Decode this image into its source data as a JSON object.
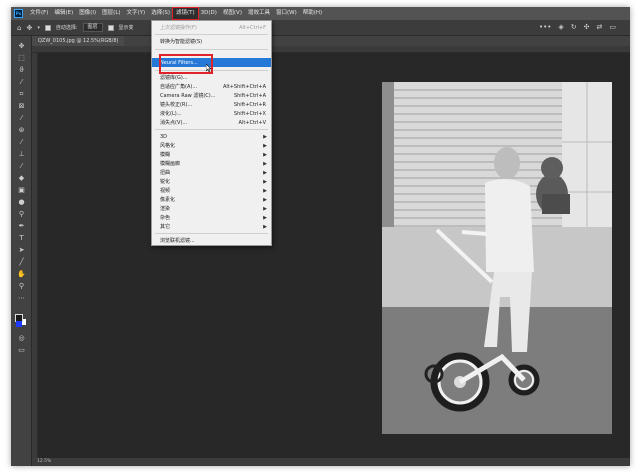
{
  "menubar": {
    "items": [
      "文件(F)",
      "编辑(E)",
      "图像(I)",
      "图层(L)",
      "文字(Y)",
      "选择(S)",
      "滤镜(T)",
      "3D(D)",
      "视图(V)",
      "增效工具",
      "窗口(W)",
      "帮助(H)"
    ],
    "active_index": 6
  },
  "options": {
    "auto_select_label": "自动选择:",
    "layer_select_value": "图层",
    "show_transform_label": "显示变"
  },
  "document": {
    "tab_title": "QZW_0105.jpg @ 12.5%(RGB/8)",
    "status_text": "12.5%"
  },
  "filter_menu": {
    "last_filter": {
      "label": "上次滤镜操作(F)",
      "shortcut": "Alt+Ctrl+F"
    },
    "convert_smart": {
      "label": "转换为智能滤镜(S)"
    },
    "neural": {
      "label": "Neural Filters..."
    },
    "group2": [
      {
        "label": "滤镜库(G)...",
        "shortcut": ""
      },
      {
        "label": "自适应广角(A)...",
        "shortcut": "Alt+Shift+Ctrl+A"
      },
      {
        "label": "Camera Raw 滤镜(C)...",
        "shortcut": "Shift+Ctrl+A"
      },
      {
        "label": "镜头校正(R)...",
        "shortcut": "Shift+Ctrl+R"
      },
      {
        "label": "液化(L)...",
        "shortcut": "Shift+Ctrl+X"
      },
      {
        "label": "消失点(V)...",
        "shortcut": "Alt+Ctrl+V"
      }
    ],
    "submenus": [
      "3D",
      "风格化",
      "模糊",
      "模糊画廊",
      "扭曲",
      "锐化",
      "视频",
      "像素化",
      "渲染",
      "杂色",
      "其它"
    ],
    "browse": {
      "label": "浏览联机滤镜..."
    }
  },
  "colors": {
    "menu_highlight": "#2678d6",
    "annotation_red": "#e0222a",
    "canvas_bg": "#282828"
  }
}
